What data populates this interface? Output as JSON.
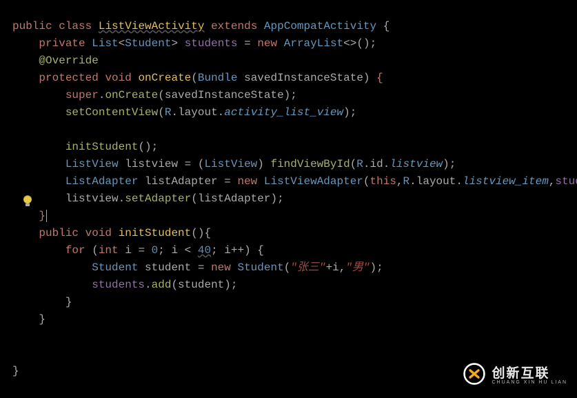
{
  "code": {
    "l1": {
      "public": "public",
      "class": "class",
      "name": "ListViewActivity",
      "extends": "extends",
      "parent": "AppCompatActivity",
      "ob": "{"
    },
    "l2": {
      "private": "private",
      "List": "List",
      "lt": "<",
      "Student": "Student",
      "gt": ">",
      "students": "students",
      "eq": "=",
      "new": "new",
      "ArrayList": "ArrayList",
      "suffix": "<>();"
    },
    "l3": {
      "override": "@Override"
    },
    "l4": {
      "protected": "protected",
      "void": "void",
      "onCreate": "onCreate",
      "lp": "(",
      "Bundle": "Bundle",
      "arg": " savedInstanceState",
      "rp": ")",
      "ob": "{"
    },
    "l5": {
      "super": "super",
      "dot": ".",
      "onCreate": "onCreate",
      "args": "(savedInstanceState);"
    },
    "l6": {
      "setContentView": "setContentView",
      "lp": "(",
      "R": "R",
      "dot1": ".",
      "layout": "layout",
      "dot2": ".",
      "id": "activity_list_view",
      "end": ");"
    },
    "l7": {
      "initStudent": "initStudent",
      "end": "();"
    },
    "l8": {
      "ListView": "ListView",
      "lv": " listview = (",
      "ListView2": "ListView",
      "rp": ") ",
      "find": "findViewById",
      "lp": "(",
      "R": "R",
      "dot1": ".",
      "id": "id",
      "dot2": ".",
      "res": "listview",
      "end": ");"
    },
    "l9": {
      "ListAdapter": "ListAdapter",
      "la": " listAdapter = ",
      "new": "new",
      "LVA": " ListViewAdapter",
      "lp": "(",
      "this": "this",
      "c1": ",",
      "R": "R",
      "dot1": ".",
      "layout": "layout",
      "dot2": ".",
      "res": "listview_item",
      "c2": ",",
      "students": "students",
      "end": ");"
    },
    "l10": {
      "pre": "listview.",
      "setAdapter": "setAdapter",
      "args": "(listAdapter);"
    },
    "l11": {
      "cb": "}"
    },
    "l12": {
      "public": "public",
      "void": "void",
      "initStudent": "initStudent",
      "end": "(){"
    },
    "l13": {
      "for": "for",
      "lp": " (",
      "int": "int",
      "i": " i = ",
      "z": "0",
      "sc": "; i < ",
      "limit": "40",
      "post": "; i++) {"
    },
    "l14": {
      "Student": "Student",
      "mid": " student = ",
      "new": "new",
      "Student2": " Student",
      "lp": "(",
      "s1": "\"张三\"",
      "plus": "+i,",
      "s2": "\"男\"",
      "end": ");"
    },
    "l15": {
      "students": "students",
      "dot": ".",
      "add": "add",
      "args": "(student);"
    },
    "l16": {
      "cb": "}"
    },
    "l17": {
      "cb": "}"
    },
    "l18": {
      "cb": "}"
    }
  },
  "watermark": {
    "zh": "创新互联",
    "en": "CHUANG XIN HU LIAN"
  }
}
